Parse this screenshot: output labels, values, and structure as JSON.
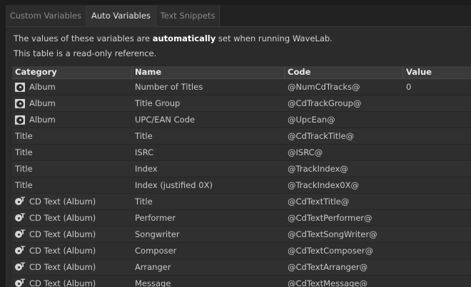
{
  "tabs": [
    {
      "label": "Custom Variables",
      "active": false
    },
    {
      "label": "Auto Variables",
      "active": true
    },
    {
      "label": "Text Snippets",
      "active": false
    }
  ],
  "description": {
    "line1_pre": "The values of these variables are ",
    "line1_bold": "automatically",
    "line1_post": " set when running WaveLab.",
    "line2": "This table is a read-only reference."
  },
  "table": {
    "columns": [
      "Category",
      "Name",
      "Code",
      "Value"
    ],
    "rows": [
      {
        "icon": "album-icon",
        "category": "Album",
        "name": "Number of Titles",
        "code": "@NumCdTracks@",
        "value": "0"
      },
      {
        "icon": "album-icon",
        "category": "Album",
        "name": "Title Group",
        "code": "@CdTrackGroup@",
        "value": ""
      },
      {
        "icon": "album-icon",
        "category": "Album",
        "name": "UPC/EAN Code",
        "code": "@UpcEan@",
        "value": ""
      },
      {
        "icon": "",
        "category": "Title",
        "name": "Title",
        "code": "@CdTrackTitle@",
        "value": ""
      },
      {
        "icon": "",
        "category": "Title",
        "name": "ISRC",
        "code": "@ISRC@",
        "value": ""
      },
      {
        "icon": "",
        "category": "Title",
        "name": "Index",
        "code": "@TrackIndex@",
        "value": ""
      },
      {
        "icon": "",
        "category": "Title",
        "name": "Index (justified 0X)",
        "code": "@TrackIndex0X@",
        "value": ""
      },
      {
        "icon": "cd-text-icon",
        "category": "CD Text (Album)",
        "name": "Title",
        "code": "@CdTextTitle@",
        "value": ""
      },
      {
        "icon": "cd-text-icon",
        "category": "CD Text (Album)",
        "name": "Performer",
        "code": "@CdTextPerformer@",
        "value": ""
      },
      {
        "icon": "cd-text-icon",
        "category": "CD Text (Album)",
        "name": "Songwriter",
        "code": "@CdTextSongWriter@",
        "value": ""
      },
      {
        "icon": "cd-text-icon",
        "category": "CD Text (Album)",
        "name": "Composer",
        "code": "@CdTextComposer@",
        "value": ""
      },
      {
        "icon": "cd-text-icon",
        "category": "CD Text (Album)",
        "name": "Arranger",
        "code": "@CdTextArranger@",
        "value": ""
      },
      {
        "icon": "cd-text-icon",
        "category": "CD Text (Album)",
        "name": "Message",
        "code": "@CdTextMessage@",
        "value": ""
      }
    ]
  }
}
